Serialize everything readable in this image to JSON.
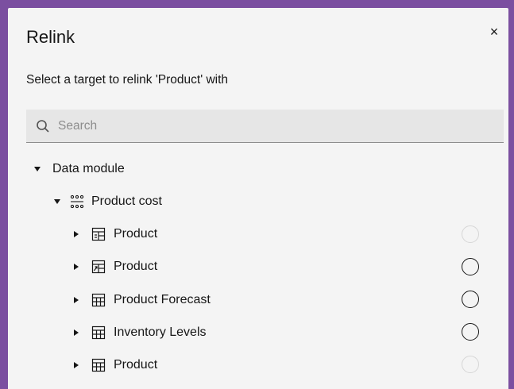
{
  "dialog": {
    "title": "Relink",
    "subtitle": "Select a target to relink 'Product' with",
    "close_label": "×"
  },
  "search": {
    "placeholder": "Search",
    "value": ""
  },
  "tree": {
    "root": {
      "label": "Data module"
    },
    "group": {
      "label": "Product cost"
    },
    "items": [
      {
        "label": "Product",
        "icon": "table-view-icon",
        "radio_enabled": false
      },
      {
        "label": "Product",
        "icon": "table-link-icon",
        "radio_enabled": true
      },
      {
        "label": "Product Forecast",
        "icon": "table-icon",
        "radio_enabled": true
      },
      {
        "label": "Inventory Levels",
        "icon": "table-icon",
        "radio_enabled": true
      },
      {
        "label": "Product",
        "icon": "table-icon",
        "radio_enabled": false
      }
    ]
  },
  "colors": {
    "frame": "#7b4fa0",
    "dialog_bg": "#f4f4f4",
    "text": "#161616",
    "search_bg": "#e6e6e6"
  }
}
